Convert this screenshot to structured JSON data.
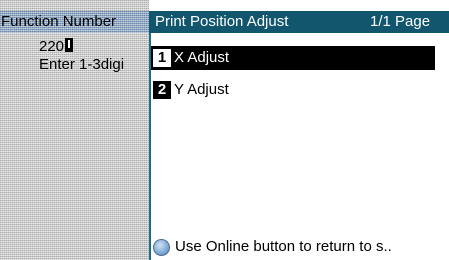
{
  "function_panel": {
    "header_label": "Function Number",
    "entered_value": "220",
    "hint": "Enter 1-3digi"
  },
  "menu": {
    "title": "Print Position Adjust",
    "page_indicator": "1/1 Page",
    "items": [
      {
        "number": "1",
        "label": "X Adjust",
        "selected": true
      },
      {
        "number": "2",
        "label": "Y Adjust",
        "selected": false
      }
    ]
  },
  "footer": {
    "icon": "online-button-icon",
    "hint": "Use Online button to return to s.."
  },
  "colors": {
    "header_bg": "#11566d",
    "selected_bg": "#000000",
    "left_panel_bg": "#c9c9c9"
  }
}
